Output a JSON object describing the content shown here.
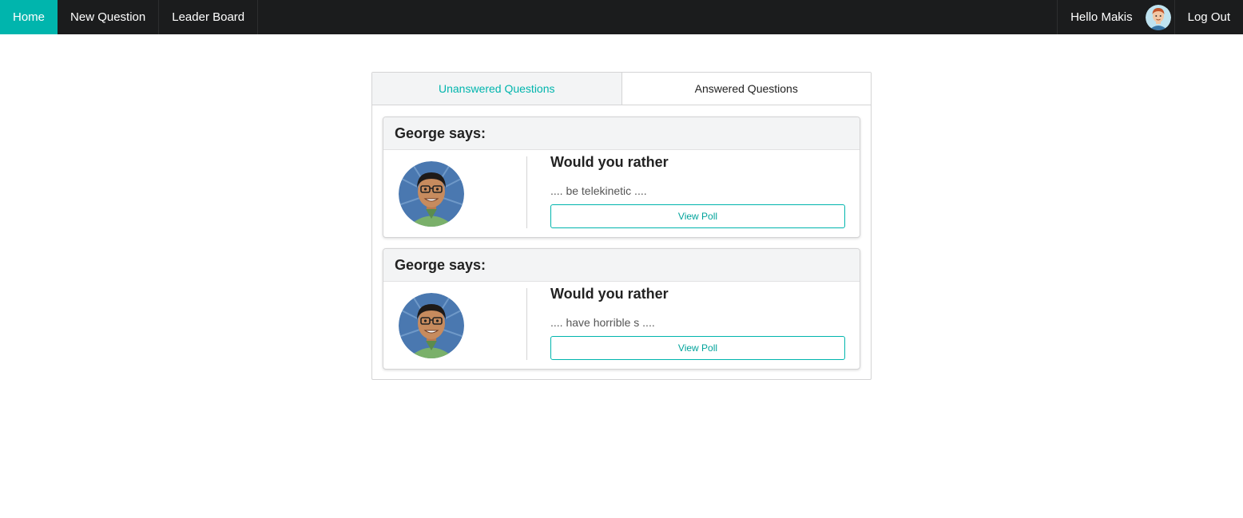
{
  "nav": {
    "home": "Home",
    "new_question": "New Question",
    "leader_board": "Leader Board",
    "greeting": "Hello Makis",
    "logout": "Log Out",
    "accent_color": "#00b5ad"
  },
  "tabs": {
    "unanswered": "Unanswered Questions",
    "answered": "Answered Questions"
  },
  "questions": [
    {
      "author_says": "George says:",
      "title": "Would you rather",
      "snippet": ".... be telekinetic ....",
      "button": "View Poll"
    },
    {
      "author_says": "George says:",
      "title": "Would you rather",
      "snippet": ".... have horrible s ....",
      "button": "View Poll"
    }
  ]
}
